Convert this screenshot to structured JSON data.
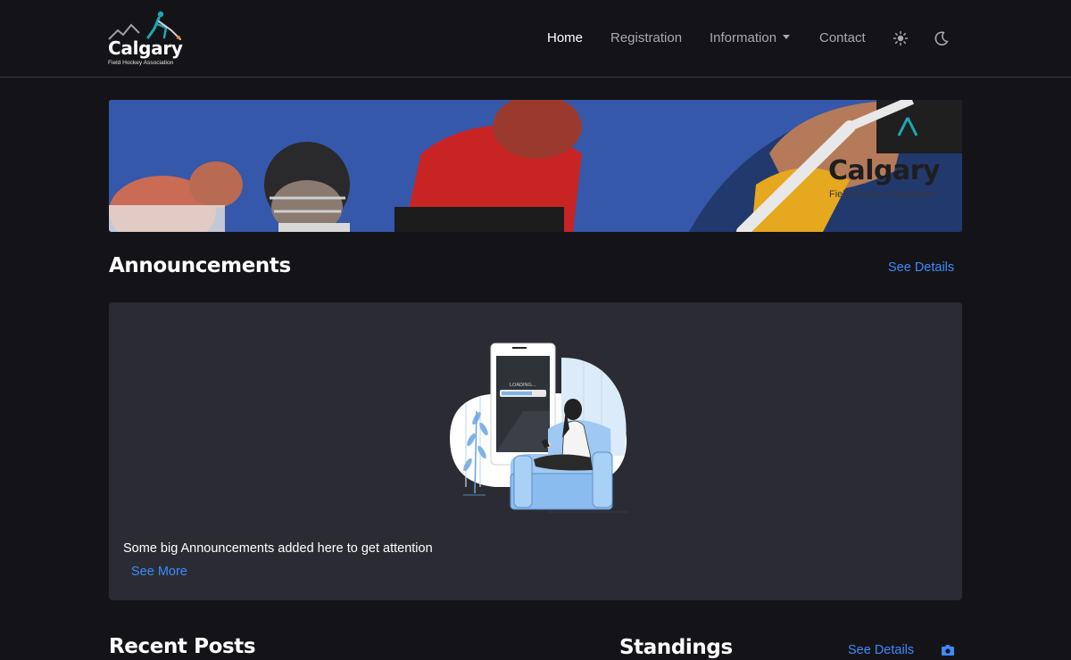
{
  "brand": {
    "name": "Calgary",
    "subtitle": "Field Hockey Association"
  },
  "nav": {
    "items": [
      {
        "label": "Home",
        "active": true
      },
      {
        "label": "Registration",
        "active": false
      },
      {
        "label": "Information",
        "active": false,
        "dropdown": true
      },
      {
        "label": "Contact",
        "active": false
      }
    ],
    "light_icon": "sun-icon",
    "dark_icon": "moon-icon"
  },
  "banner": {
    "logo_name": "Calgary",
    "logo_subtitle": "Field Hockey Association"
  },
  "announcements": {
    "title": "Announcements",
    "see_details": "See Details",
    "illustration_text": "LOADING...",
    "body": "Some big Announcements added here to get attention",
    "see_more": "See More"
  },
  "recent_posts": {
    "title": "Recent Posts"
  },
  "standings": {
    "title": "Standings",
    "see_details": "See Details",
    "icon": "camera-icon"
  },
  "colors": {
    "background": "#141418",
    "card": "#2b2c33",
    "link": "#3d8bfd",
    "nav_muted": "#a8a8ae"
  }
}
